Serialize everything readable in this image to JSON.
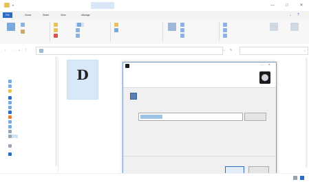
{
  "window": {
    "title_placeholder": "",
    "context_tab": "",
    "controls": [
      "—",
      "□",
      "✕"
    ]
  },
  "ribbon_tabs": [
    "File",
    "Home",
    "Share",
    "View",
    "Manage"
  ],
  "ribbon": {
    "groups": [
      "",
      "",
      "",
      "",
      ""
    ],
    "items": [
      "",
      "",
      "",
      "",
      "",
      "",
      "",
      "",
      "",
      "",
      "",
      "",
      "",
      "",
      "",
      "",
      "",
      ""
    ]
  },
  "address": {
    "path": "",
    "search_placeholder": ""
  },
  "nav": {
    "items": [
      "",
      "",
      "",
      "",
      "",
      "",
      "",
      "",
      "",
      "",
      "",
      "",
      "",
      "",
      ""
    ]
  },
  "file": {
    "label": ""
  },
  "dialog": {
    "title": "",
    "heading": "",
    "subheading": "",
    "paragraph1": "",
    "paragraph2": "",
    "browse_label": "",
    "next_label": "",
    "cancel_label": "",
    "close_glyph": "✕"
  },
  "status": {
    "text": ""
  },
  "colors": {
    "accent": "#2b6cc4",
    "selection": "#cce4f7",
    "dialog_border": "#7a9cc8"
  },
  "icons": [
    "folder-icon",
    "back-icon",
    "forward-icon",
    "up-icon",
    "refresh-icon",
    "search-icon",
    "pc-icon",
    "network-icon",
    "installer-icon"
  ]
}
